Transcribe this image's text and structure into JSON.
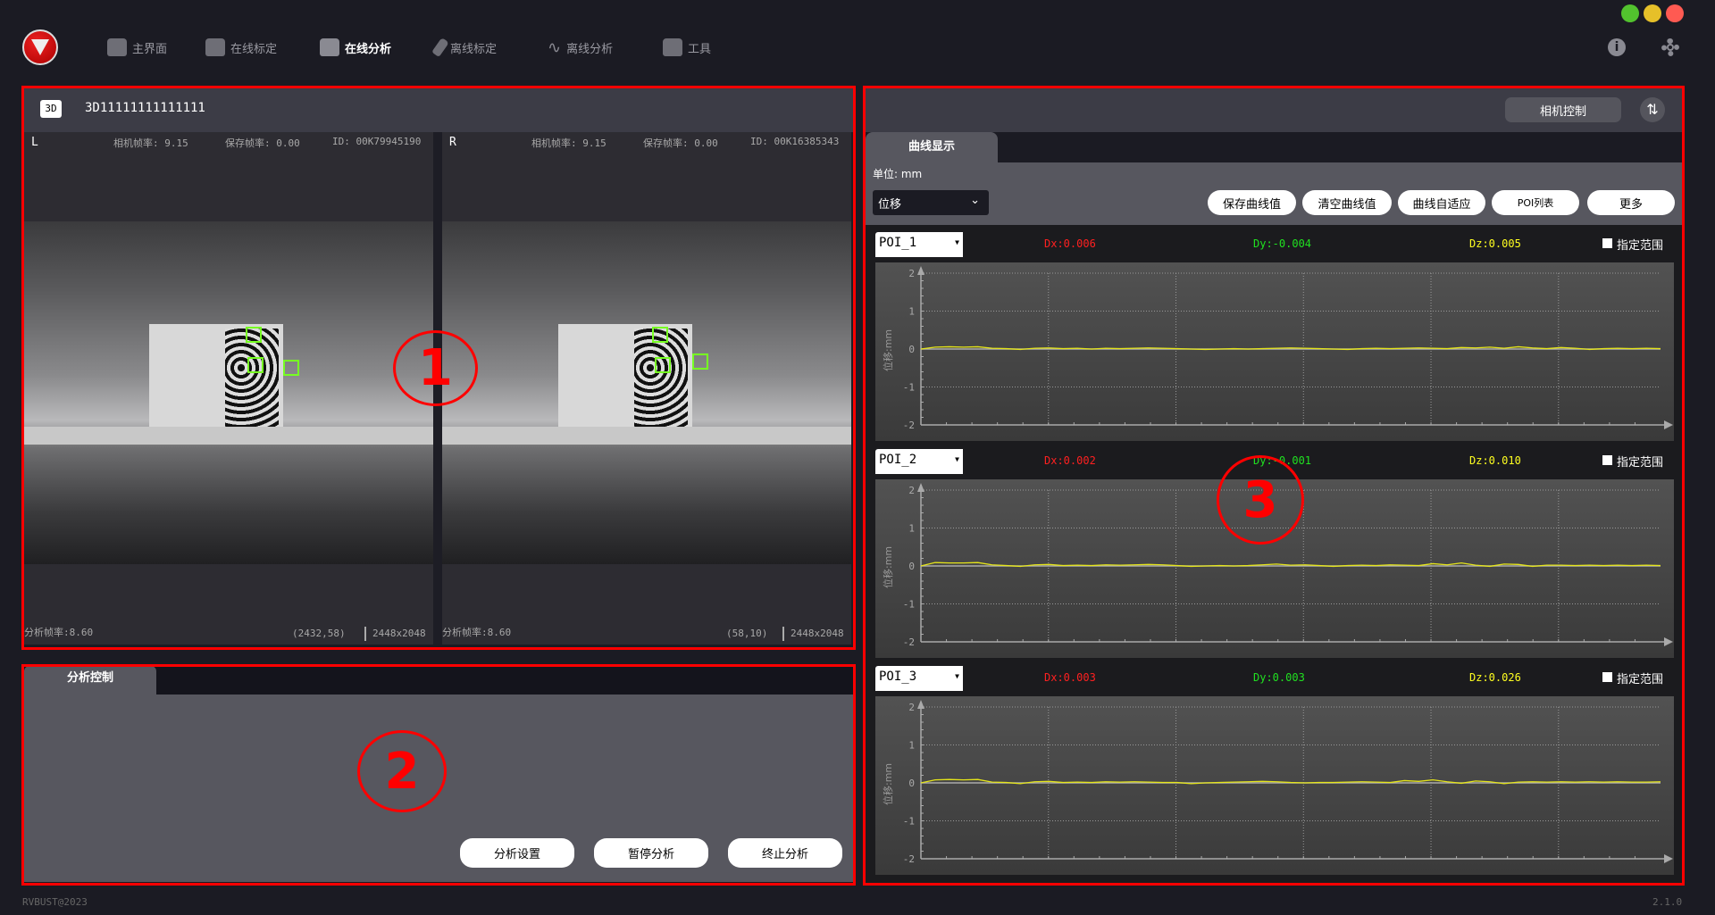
{
  "nav": {
    "items": [
      {
        "label": "主界面",
        "icon": "home-icon"
      },
      {
        "label": "在线标定",
        "icon": "online-calibration-icon"
      },
      {
        "label": "在线分析",
        "icon": "online-analysis-icon",
        "active": true
      },
      {
        "label": "离线标定",
        "icon": "offline-calibration-icon"
      },
      {
        "label": "离线分析",
        "icon": "offline-analysis-icon"
      },
      {
        "label": "工具",
        "icon": "toolbox-icon"
      }
    ]
  },
  "window": {
    "colors": {
      "green": "#52c22e",
      "yellow": "#e6c029",
      "red": "#ff5a52"
    }
  },
  "camera_panel": {
    "badge": "3D",
    "title": "3D11111111111111",
    "left": {
      "side": "L",
      "cam_fps": "相机帧率: 9.15",
      "save_fps": "保存帧率: 0.00",
      "id": "ID: 00K79945190",
      "analysis_fps": "分析帧率:8.60",
      "coord": "(2432,58)",
      "resolution": "2448x2048"
    },
    "right": {
      "side": "R",
      "cam_fps": "相机帧率: 9.15",
      "save_fps": "保存帧率: 0.00",
      "id": "ID: 00K16385343",
      "analysis_fps": "分析帧率:8.60",
      "coord": "(58,10)",
      "resolution": "2448x2048"
    }
  },
  "control_panel": {
    "tab": "分析控制",
    "buttons": [
      "分析设置",
      "暂停分析",
      "终止分析"
    ]
  },
  "annotations": [
    "1",
    "2",
    "3"
  ],
  "right_panel": {
    "camera_control": "相机控制",
    "tab": "曲线显示",
    "unit": "单位: mm",
    "mode_select": "位移",
    "buttons": [
      "保存曲线值",
      "清空曲线值",
      "曲线自适应",
      "POI列表",
      "更多"
    ],
    "range_label": "指定范围",
    "colors": {
      "dx": "#ff2020",
      "dy": "#20e020",
      "dz": "#ffff20"
    }
  },
  "footer": {
    "copyright": "RVBUST@2023",
    "version": "2.1.0"
  },
  "chart_data": [
    {
      "type": "line",
      "poi": "POI_1",
      "dx": "Dx:0.006",
      "dy": "Dy:-0.004",
      "dz": "Dz:0.005",
      "ylabel": "位移:mm",
      "ylim": [
        -2,
        2
      ],
      "yticks": [
        "2",
        "1",
        "0",
        "-1",
        "-2"
      ],
      "grid": true,
      "values": [
        0,
        0.05,
        0.06,
        0.05,
        0.06,
        0.02,
        0.01,
        -0.01,
        0.02,
        0.03,
        0.01,
        0.02,
        0,
        0.02,
        0.01,
        0.02,
        0.03,
        0.02,
        0.01,
        0,
        -0.01,
        0,
        0.01,
        0,
        0.01,
        0.02,
        0.03,
        0.02,
        0.01,
        0,
        -0.01,
        0.01,
        0.02,
        0.01,
        0.02,
        0.03,
        0.02,
        0.01,
        0.04,
        0.03,
        0.05,
        0.02,
        0.06,
        0.03,
        0.01,
        0.04,
        0.02,
        -0.01,
        0.01,
        0.02,
        0.01,
        0.02,
        0.01
      ]
    },
    {
      "type": "line",
      "poi": "POI_2",
      "dx": "Dx:0.002",
      "dy": "Dy:-0.001",
      "dz": "Dz:0.010",
      "ylabel": "位移:mm",
      "ylim": [
        -2,
        2
      ],
      "yticks": [
        "2",
        "1",
        "0",
        "-1",
        "-2"
      ],
      "grid": true,
      "values": [
        0,
        0.09,
        0.08,
        0.08,
        0.09,
        0.03,
        0.01,
        -0.01,
        0.03,
        0.04,
        0.01,
        0.02,
        0.01,
        0.03,
        0.02,
        0.03,
        0.04,
        0.03,
        0.01,
        -0.01,
        0,
        0.01,
        0,
        0.01,
        0.03,
        0.05,
        0.02,
        0.03,
        0.01,
        -0.01,
        0.01,
        0.02,
        0.01,
        0.03,
        0.02,
        0.01,
        0.06,
        0.03,
        0.08,
        0.02,
        -0.01,
        0.05,
        0.04,
        -0.01,
        0.02,
        0.02,
        0.01,
        0.02,
        0.01,
        0.02,
        0.01,
        0.02,
        0.01
      ]
    },
    {
      "type": "line",
      "poi": "POI_3",
      "dx": "Dx:0.003",
      "dy": "Dy:0.003",
      "dz": "Dz:0.026",
      "ylabel": "位移:mm",
      "ylim": [
        -2,
        2
      ],
      "yticks": [
        "2",
        "1",
        "0",
        "-1",
        "-2"
      ],
      "grid": true,
      "values": [
        0,
        0.08,
        0.09,
        0.08,
        0.09,
        0.02,
        0.01,
        -0.02,
        0.03,
        0.04,
        0.01,
        0.02,
        0.01,
        0.03,
        0.02,
        0.03,
        0.02,
        0.01,
        0.01,
        -0.02,
        0,
        0.01,
        0.02,
        0.03,
        0.04,
        0.03,
        0.01,
        0,
        0.01,
        0.01,
        0.02,
        0.03,
        0.02,
        0.01,
        0.06,
        0.04,
        0.08,
        0.03,
        -0.01,
        0.05,
        0.03,
        -0.02,
        0.02,
        0.03,
        0.02,
        0.03,
        0.02,
        0.03,
        0.02,
        0.03,
        0.02,
        0.02,
        0.03
      ]
    }
  ]
}
